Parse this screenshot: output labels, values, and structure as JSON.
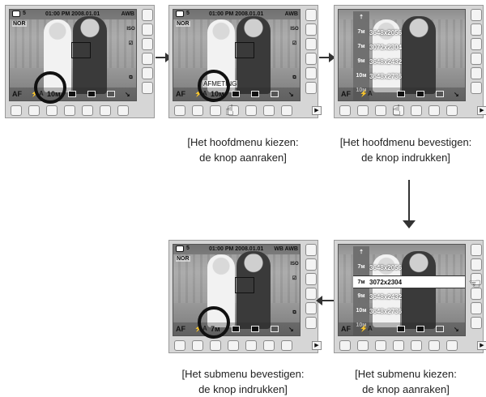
{
  "osd": {
    "shots": "5",
    "datetime": "01:00 PM 2008.01.01",
    "wb": "AWB",
    "wb_alt": "WB AWB",
    "quality": "NOR",
    "af": "AF",
    "flash": "⚡A",
    "size_main": "10м",
    "size_selected": "7м",
    "menu_label": "AFMETING",
    "iso": "ISO",
    "play": "▶",
    "wrench": "↘"
  },
  "size_menu": {
    "items": [
      {
        "icon": "⇡",
        "label": ""
      },
      {
        "icon": "7м",
        "label": "3648x2056"
      },
      {
        "icon": "7м",
        "label": "3072x2304"
      },
      {
        "icon": "9м",
        "label": "3648x2432"
      },
      {
        "icon": "10м",
        "label": "3648x2736"
      },
      {
        "icon": "10м",
        "label": ""
      }
    ]
  },
  "captions": {
    "step1": [
      "[Het hoofdmenu kiezen:",
      "de knop aanraken]"
    ],
    "step2": [
      "[Het hoofdmenu bevestigen:",
      "de knop indrukken]"
    ],
    "step3": [
      "[Het submenu bevestigen:",
      "de knop indrukken]"
    ],
    "step4": [
      "[Het submenu kiezen:",
      "de knop aanraken]"
    ]
  },
  "icons": {
    "camera": "camera-mode-icon",
    "hand": "touch-hand-icon",
    "arrow_right": "arrow-right-icon",
    "arrow_down": "arrow-down-icon",
    "arrow_left": "arrow-left-icon"
  }
}
